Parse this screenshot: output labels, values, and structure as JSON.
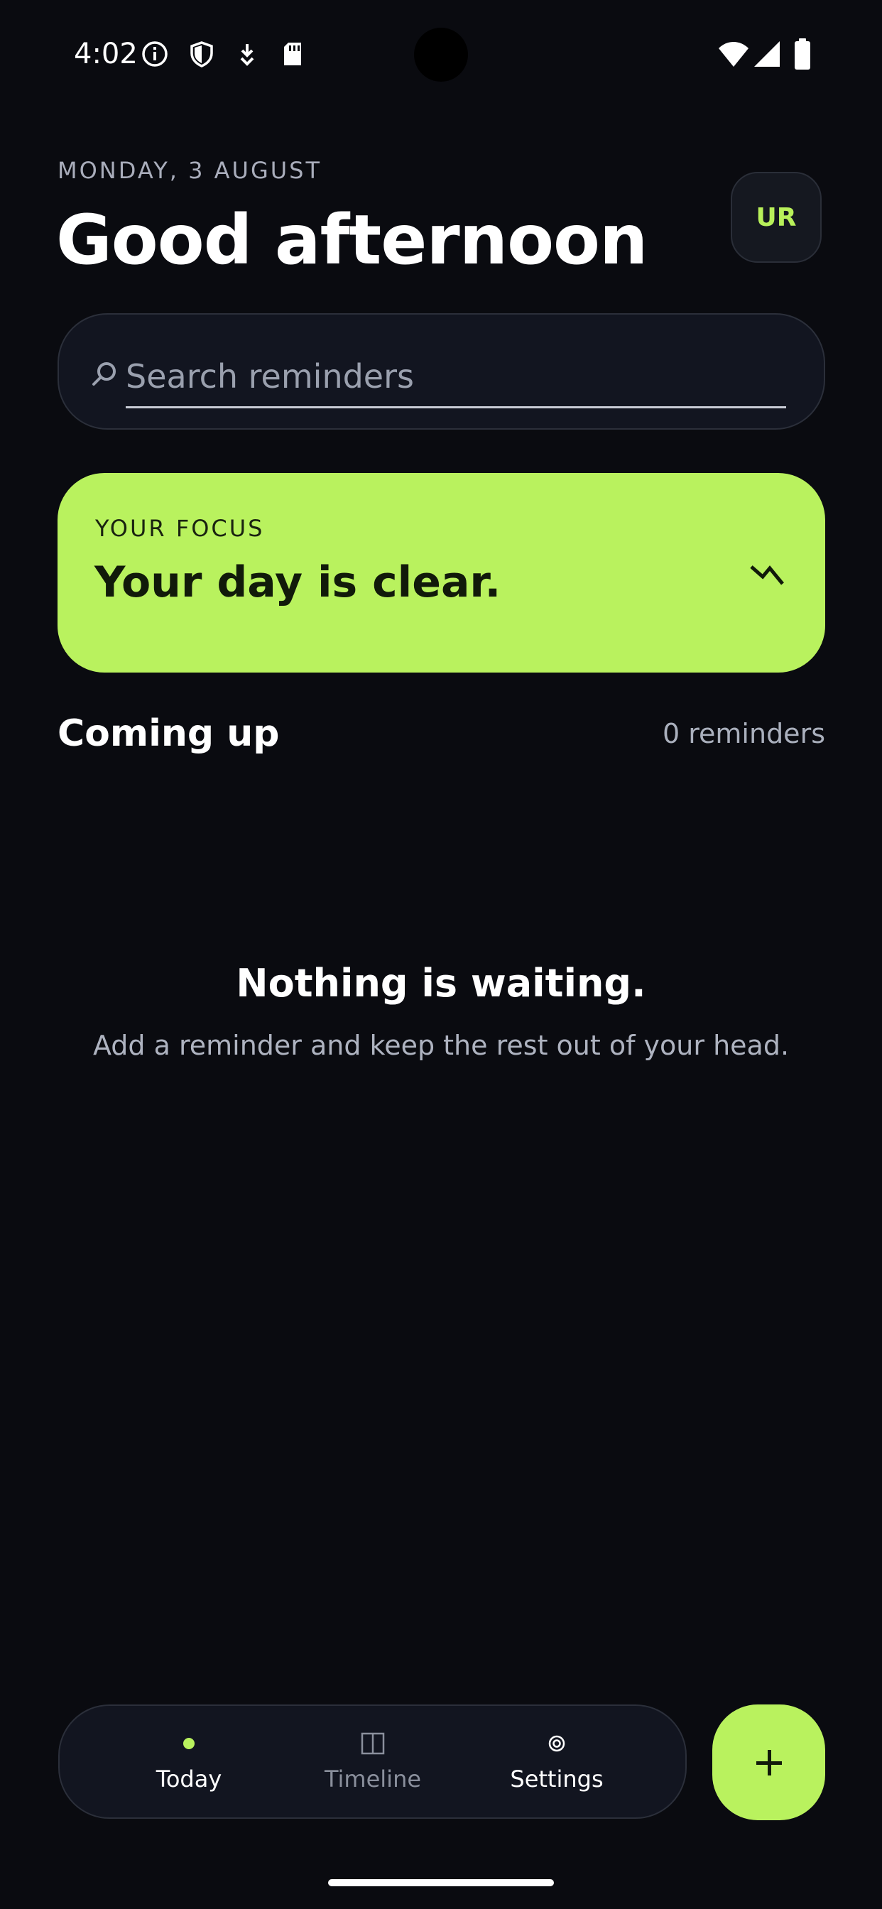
{
  "status_bar": {
    "time": "4:02",
    "left_icons": [
      "info-icon",
      "shield-icon",
      "download-icon",
      "sd-card-icon"
    ],
    "right_icons": [
      "wifi-icon",
      "signal-icon",
      "battery-icon"
    ]
  },
  "header": {
    "date": "MONDAY, 3 AUGUST",
    "greeting": "Good afternoon",
    "avatar_initials": "UR"
  },
  "search": {
    "placeholder": "Search reminders",
    "value": ""
  },
  "focus_card": {
    "label": "YOUR FOCUS",
    "title": "Your day is clear.",
    "icon": "bolt-icon"
  },
  "coming_up": {
    "title": "Coming up",
    "count": "0 reminders"
  },
  "empty_state": {
    "title": "Nothing is waiting.",
    "subtitle": "Add a reminder and keep the rest out of your head."
  },
  "nav": {
    "items": [
      {
        "label": "Today",
        "icon": "dot-indicator",
        "active": true
      },
      {
        "label": "Timeline",
        "icon": "timeline-icon",
        "active": false
      },
      {
        "label": "Settings",
        "icon": "settings-icon",
        "active": false
      }
    ]
  },
  "fab": {
    "icon": "plus-icon"
  },
  "colors": {
    "background": "#0a0b10",
    "accent": "#b9f25e",
    "surface": "#121520",
    "muted_text": "#aab0bd"
  }
}
